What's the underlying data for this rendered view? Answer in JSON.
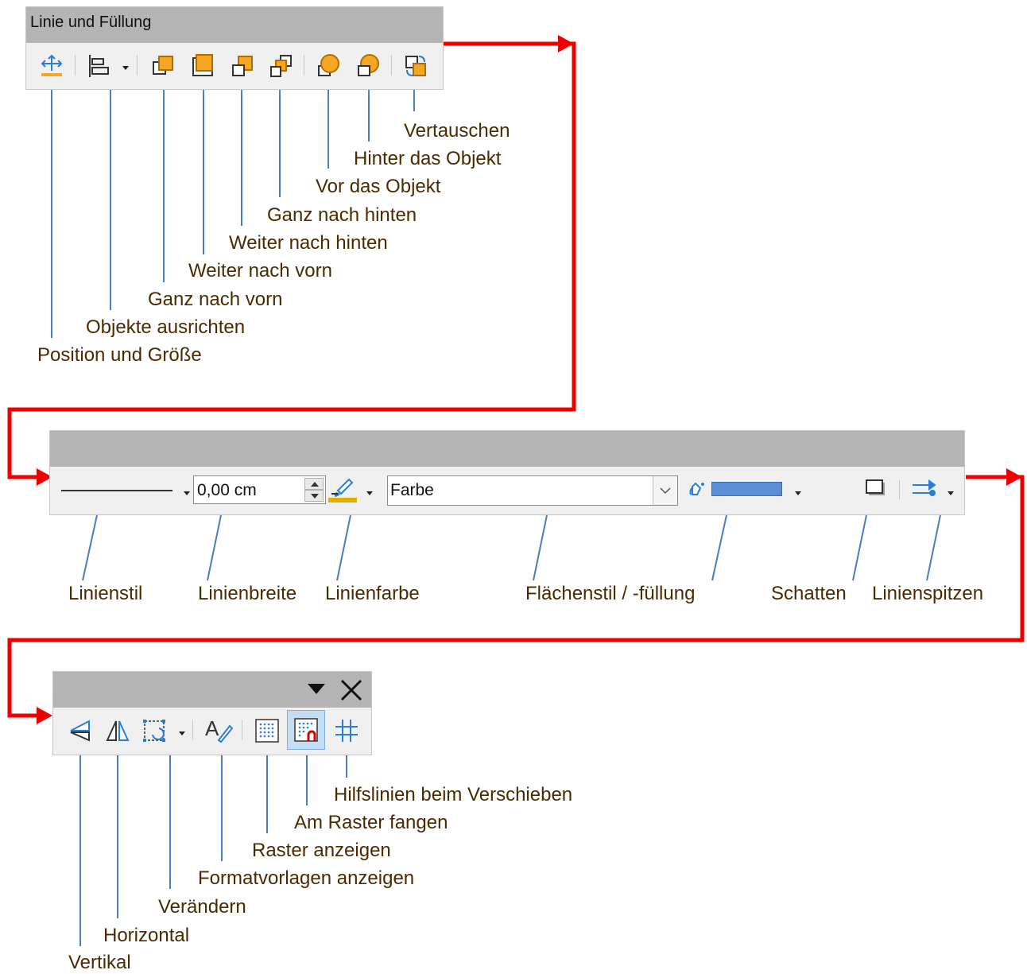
{
  "toolbar_top": {
    "title": "Linie und Füllung"
  },
  "toolbar_middle": {
    "line_width_value": "0,00 cm",
    "area_style_value": "Farbe"
  },
  "labels_top": [
    "Vertauschen",
    "Hinter das Objekt",
    "Vor das Objekt",
    "Ganz nach hinten",
    "Weiter nach hinten",
    "Weiter nach vorn",
    "Ganz nach vorn",
    "Objekte ausrichten",
    "Position und Größe"
  ],
  "labels_middle": [
    "Linienstil",
    "Linienbreite",
    "Linienfarbe",
    "Flächenstil / -füllung",
    "Schatten",
    "Linienspitzen"
  ],
  "labels_bottom": [
    "Hilfslinien beim Verschieben",
    "Am Raster fangen",
    "Raster anzeigen",
    "Formatvorlagen anzeigen",
    "Verändern",
    "Horizontal",
    "Vertikal"
  ],
  "colors": {
    "callout_line": "#4a7ebf",
    "flow_arrow": "#ee0000",
    "label_text": "#4a2b00",
    "titlebar": "#b4b4b4",
    "toolbar_bg": "#f0f0f0",
    "icon_orange": "#f5a623",
    "icon_blue": "#2a7fd4",
    "fill_color": "#5b8ed6",
    "line_color_bar": "#e3b000"
  }
}
